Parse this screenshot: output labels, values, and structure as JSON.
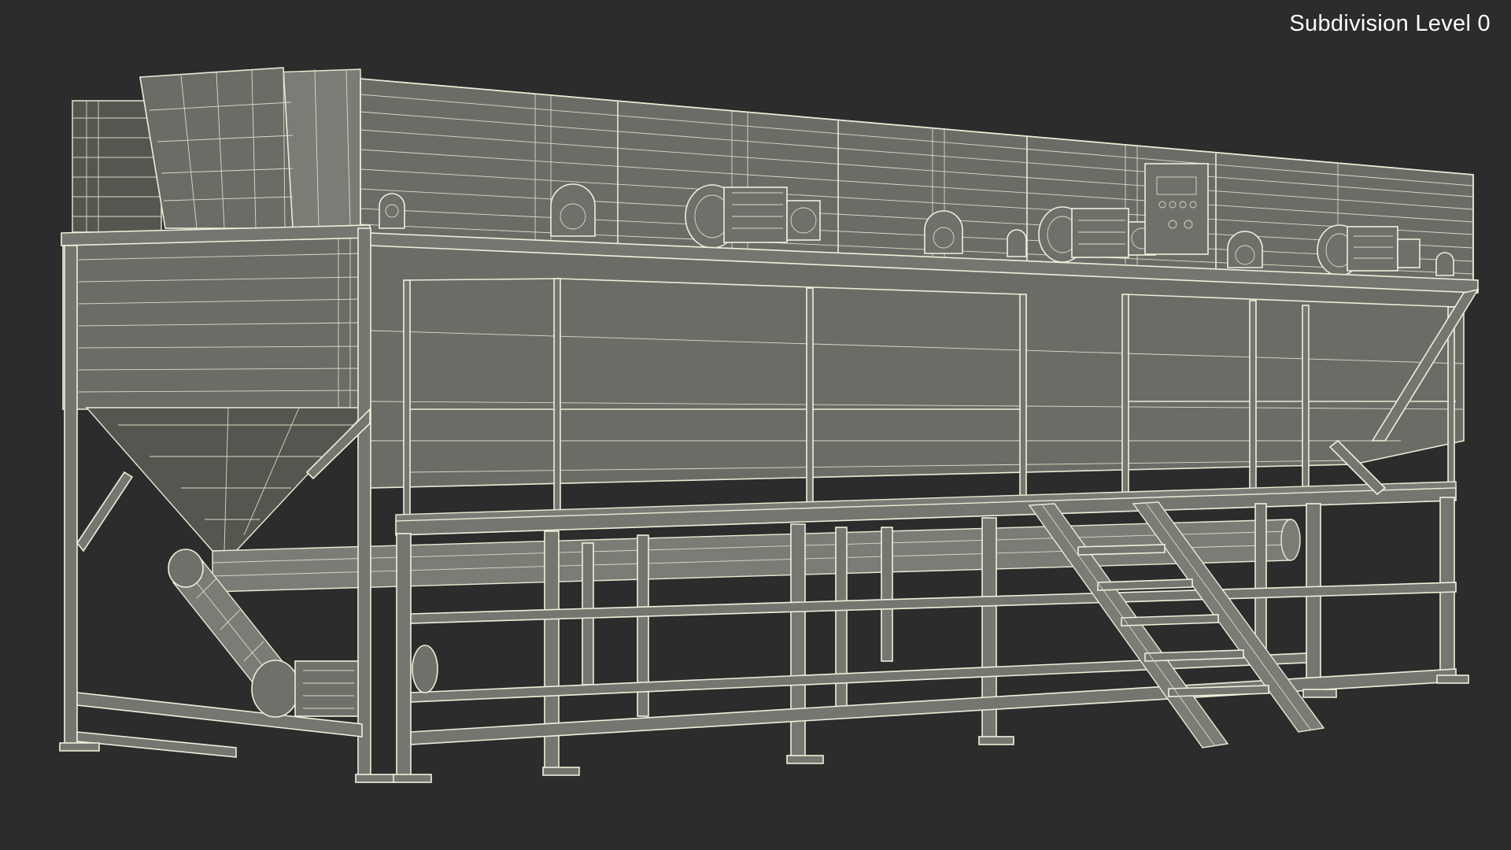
{
  "viewport": {
    "background_color": "#2c2c2c",
    "wire_color": "#e9ecd6",
    "surface_color": "#6b6c66"
  },
  "overlay": {
    "subdivision_label": "Subdivision Level 0"
  },
  "model": {
    "icon": "screw-conveyor-wireframe-icon"
  }
}
